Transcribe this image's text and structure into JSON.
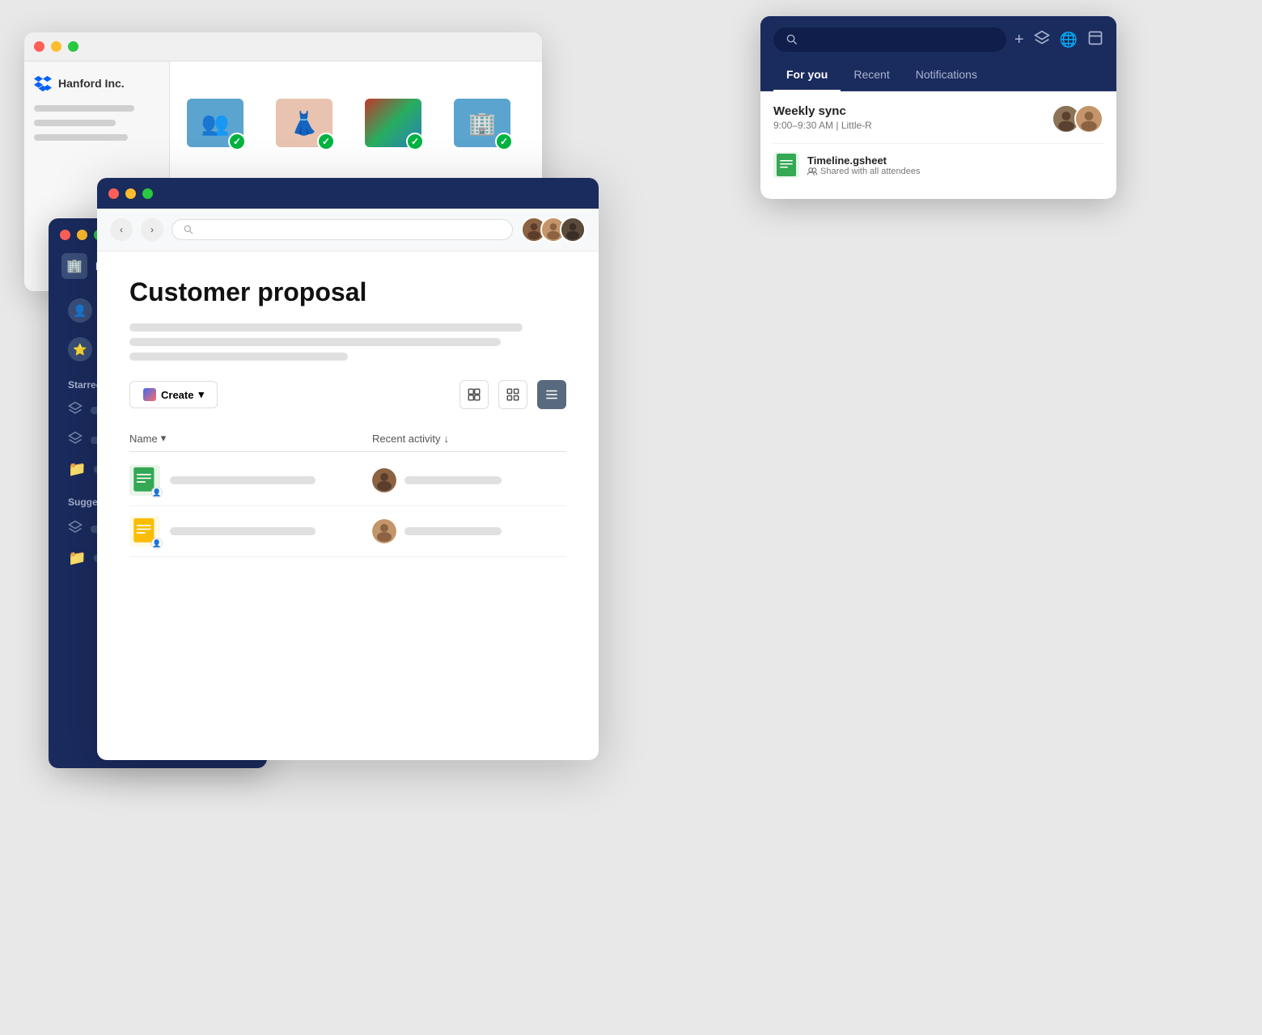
{
  "win_back": {
    "title": "",
    "sidebar": {
      "logo": "📦",
      "org_name": "Hanford Inc.",
      "lines": [
        {
          "width": "80%"
        },
        {
          "width": "60%"
        },
        {
          "width": "70%"
        }
      ]
    },
    "folders": [
      {
        "type": "people",
        "checked": true
      },
      {
        "type": "image1",
        "checked": true
      },
      {
        "type": "image2",
        "checked": true
      },
      {
        "type": "building",
        "checked": true
      },
      {
        "type": "ai",
        "checked": false
      },
      {
        "type": "sheets",
        "checked": false
      },
      {
        "type": "folder_plain",
        "checked": false
      },
      {
        "type": "photo",
        "checked": false
      }
    ]
  },
  "win_notif": {
    "search_placeholder": "Search",
    "tabs": [
      {
        "label": "For you",
        "active": true
      },
      {
        "label": "Recent",
        "active": false
      },
      {
        "label": "Notifications",
        "active": false
      }
    ],
    "actions": [
      "+",
      "⬡",
      "🌐",
      "⬜"
    ],
    "card": {
      "title": "Weekly sync",
      "subtitle": "9:00–9:30 AM | Little-R",
      "file_name": "Timeline.gsheet",
      "file_shared": "Shared with all attendees"
    }
  },
  "win_sidebar": {
    "org_name": "Hanford Inc.",
    "items": [
      {
        "icon": "👤",
        "type": "person"
      },
      {
        "icon": "⭐",
        "type": "starred"
      }
    ],
    "sections": [
      {
        "title": "Starred folders",
        "items": [
          {
            "icon": "layers",
            "text_width": "160px"
          },
          {
            "icon": "layers",
            "text_width": "200px"
          },
          {
            "icon": "folder",
            "text_width": "120px"
          }
        ]
      },
      {
        "title": "Suggested for you ✦",
        "items": [
          {
            "icon": "layers",
            "text_width": "160px"
          },
          {
            "icon": "folder",
            "text_width": "160px"
          }
        ]
      }
    ]
  },
  "win_main": {
    "doc_title": "Customer proposal",
    "toolbar": {
      "create_label": "Create",
      "create_chevron": "▾"
    },
    "table": {
      "col_name": "Name",
      "col_activity": "Recent activity",
      "rows": [
        {
          "file_type": "gsheet",
          "activity_color": "#b0c4de"
        },
        {
          "file_type": "doc",
          "activity_color": "#f0c060"
        }
      ]
    }
  },
  "colors": {
    "navy": "#1a2b5e",
    "accent_blue": "#3c6df0",
    "green_check": "#00b341",
    "sheets_green": "#34a853",
    "doc_yellow": "#fbbc04"
  }
}
